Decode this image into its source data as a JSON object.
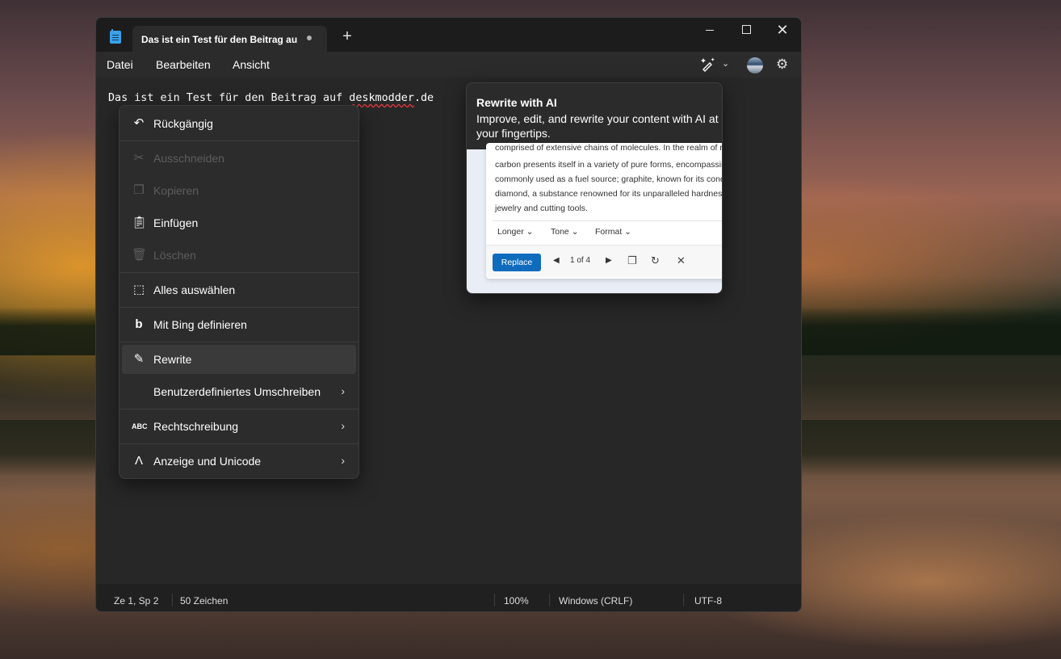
{
  "window": {
    "tab_title": "Das ist ein Test für den Beitrag au",
    "new_tab_symbol": "+",
    "close_symbol": "✕"
  },
  "menubar": {
    "items": [
      "Datei",
      "Bearbeiten",
      "Ansicht"
    ]
  },
  "editor": {
    "text_before": "Das ist ein Test für den Beitrag auf ",
    "misspelled": "deskmodder",
    "text_after": ".de"
  },
  "context_menu": {
    "items": [
      {
        "label": "Rückgängig",
        "icon": "undo-icon",
        "enabled": true
      },
      {
        "label": "Ausschneiden",
        "icon": "cut-icon",
        "enabled": false
      },
      {
        "label": "Kopieren",
        "icon": "copy-icon",
        "enabled": false
      },
      {
        "label": "Einfügen",
        "icon": "paste-icon",
        "enabled": true
      },
      {
        "label": "Löschen",
        "icon": "delete-icon",
        "enabled": false
      },
      {
        "label": "Alles auswählen",
        "icon": "select-all-icon",
        "enabled": true
      },
      {
        "label": "Mit Bing definieren",
        "icon": "bing-icon",
        "enabled": true
      },
      {
        "label": "Rewrite",
        "icon": "rewrite-pen-icon",
        "enabled": true,
        "highlighted": true
      },
      {
        "label": "Benutzerdefiniertes Umschreiben",
        "enabled": true,
        "submenu": true
      },
      {
        "label": "Rechtschreibung",
        "icon": "spelling-icon",
        "enabled": true,
        "submenu": true
      },
      {
        "label": "Anzeige und Unicode",
        "icon": "unicode-icon",
        "enabled": true,
        "submenu": true
      }
    ]
  },
  "tooltip": {
    "title": "Rewrite with AI",
    "description": "Improve, edit, and rewrite your content with AI at your fingertips.",
    "preview": {
      "lines": [
        "comprised of extensive chains of molecules. In the realm of n",
        "carbon presents itself in a variety of pure forms, encompassin",
        "commonly used as a fuel source; graphite, known for its cond",
        "diamond, a substance renowned for its unparalleled hardness",
        "jewelry and cutting tools."
      ],
      "options": [
        "Longer",
        "Tone",
        "Format"
      ],
      "replace_label": "Replace",
      "page_indicator": "1 of 4"
    }
  },
  "statusbar": {
    "position": "Ze 1, Sp 2",
    "chars": "50 Zeichen",
    "zoom": "100%",
    "line_ending": "Windows (CRLF)",
    "encoding": "UTF-8"
  },
  "colors": {
    "accent": "#0f6cbd",
    "window_bg": "#272727",
    "spell_error": "#e0383e"
  }
}
